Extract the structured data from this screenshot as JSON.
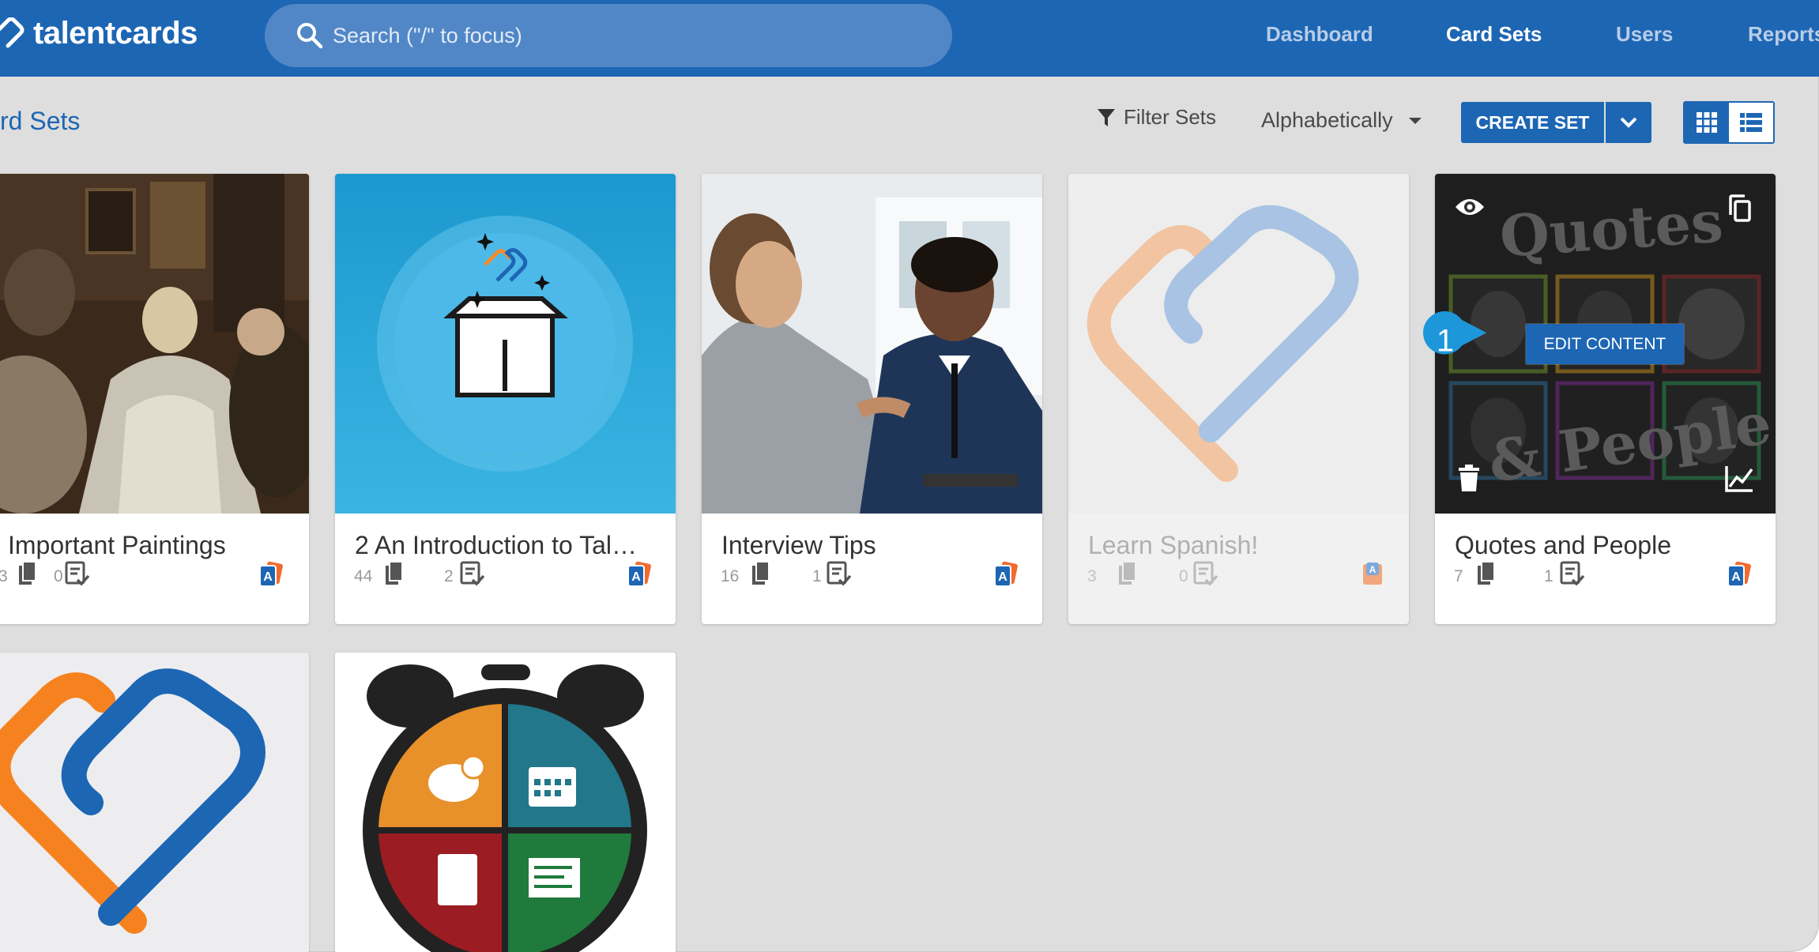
{
  "topbar": {
    "brand": "talentcards",
    "search_placeholder": "Search (\"/\" to focus)",
    "nav": [
      "Dashboard",
      "Card Sets",
      "Users",
      "Reports"
    ],
    "active_nav": "Card Sets",
    "color": "#1d66b4"
  },
  "toolbar": {
    "page_title": "rd Sets",
    "filter_label": "Filter Sets",
    "sort_label": "Alphabetically",
    "create_label": "CREATE SET"
  },
  "cards": [
    {
      "title": "Important Paintings",
      "cards_count": "3",
      "tests_count": "0"
    },
    {
      "title": "2 An Introduction to Tal…",
      "cards_count": "44",
      "tests_count": "2"
    },
    {
      "title": "Interview Tips",
      "cards_count": "16",
      "tests_count": "1"
    },
    {
      "title": "Learn Spanish!",
      "cards_count": "3",
      "tests_count": "0"
    },
    {
      "title": "Quotes and People",
      "cards_count": "7",
      "tests_count": "1",
      "image_text_1": "Quotes",
      "image_text_2": "& People"
    }
  ],
  "hover": {
    "edit_label": "EDIT CONTENT",
    "step_number": "1"
  },
  "icons": {
    "preview": "eye-icon",
    "duplicate": "copy-icon",
    "delete": "trash-icon",
    "stats": "chart-icon",
    "cards": "cards-icon",
    "tests": "test-icon",
    "language": "language-badge-icon"
  }
}
